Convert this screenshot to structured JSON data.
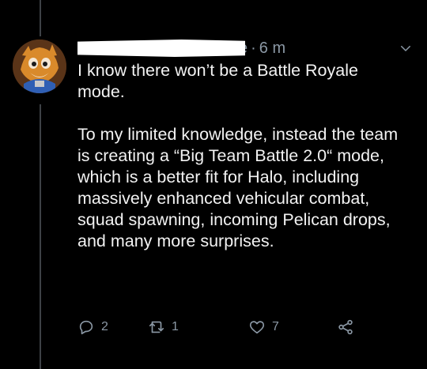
{
  "tweet": {
    "username_tail": "e",
    "separator": "·",
    "time": "6 m",
    "text": "I know there won’t be a Battle Royale mode.\n\nTo my limited knowledge, instead the team is creating a “Big Team Battle 2.0“ mode, which is a better fit for Halo, including massively enhanced vehicular combat, squad spawning, incoming Pelican drops, and many more surprises.",
    "replies": "2",
    "retweets": "1",
    "likes": "7"
  },
  "icons": {
    "reply": "reply-icon",
    "retweet": "retweet-icon",
    "like": "heart-icon",
    "share": "share-icon",
    "menu": "chevron-down-icon"
  },
  "colors": {
    "background": "#000000",
    "text": "#ffffff",
    "secondary": "#8b98a5",
    "thread": "#3d4146"
  }
}
